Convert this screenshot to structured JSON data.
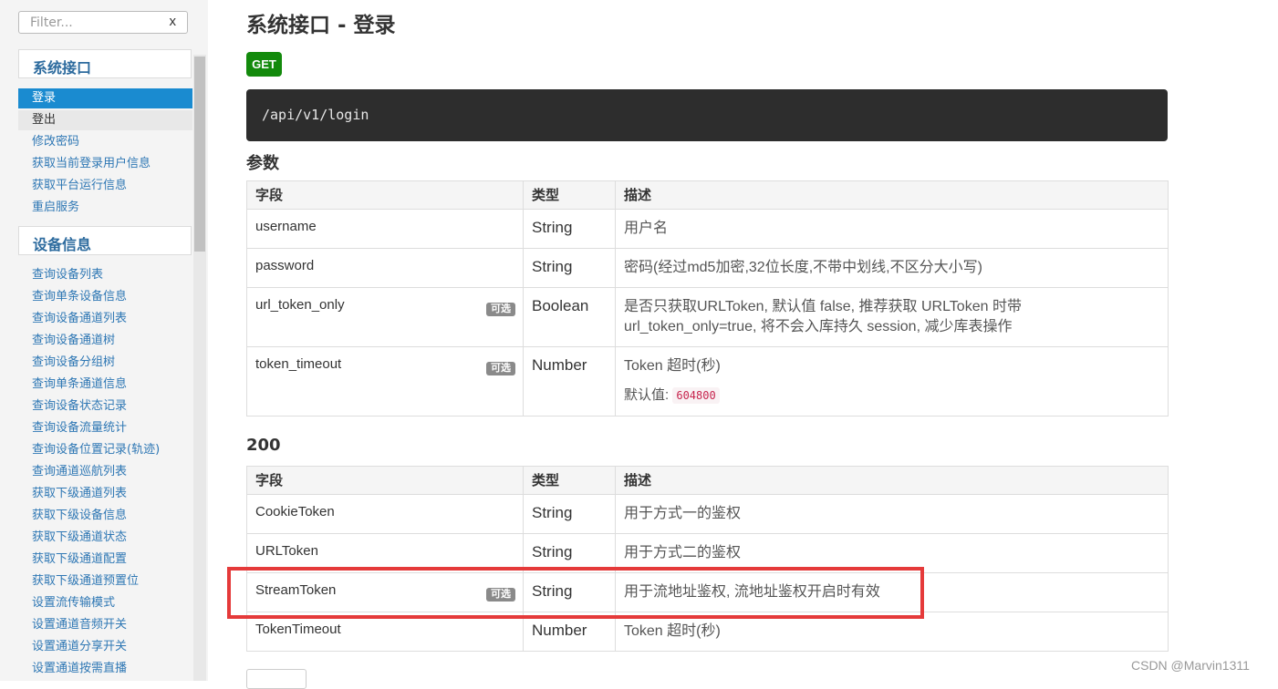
{
  "sidebar": {
    "filter_placeholder": "Filter...",
    "filter_clear": "x",
    "groups": [
      {
        "title": "系统接口",
        "items": [
          "登录",
          "登出",
          "修改密码",
          "获取当前登录用户信息",
          "获取平台运行信息",
          "重启服务"
        ]
      },
      {
        "title": "设备信息",
        "items": [
          "查询设备列表",
          "查询单条设备信息",
          "查询设备通道列表",
          "查询设备通道树",
          "查询设备分组树",
          "查询单条通道信息",
          "查询设备状态记录",
          "查询设备流量统计",
          "查询设备位置记录(轨迹)",
          "查询通道巡航列表",
          "获取下级通道列表",
          "获取下级设备信息",
          "获取下级通道状态",
          "获取下级通道配置",
          "获取下级通道预置位",
          "设置流传输模式",
          "设置通道音频开关",
          "设置通道分享开关",
          "设置通道按需直播"
        ]
      }
    ]
  },
  "main": {
    "title": "系统接口 - 登录",
    "method": "GET",
    "endpoint": "/api/v1/login",
    "params_title": "参数",
    "response_title": "200",
    "headers": [
      "字段",
      "类型",
      "描述"
    ],
    "optional_label": "可选",
    "default_label": "默认值:",
    "params": [
      {
        "field": "username",
        "type": "String",
        "desc": "用户名"
      },
      {
        "field": "password",
        "type": "String",
        "desc": "密码(经过md5加密,32位长度,不带中划线,不区分大小写)"
      },
      {
        "field": "url_token_only",
        "type": "Boolean",
        "desc_line1": "是否只获取URLToken, 默认值 false, 推荐获取 URLToken 时带",
        "desc_line2": "url_token_only=true, 将不会入库持久 session, 减少库表操作"
      },
      {
        "field": "token_timeout",
        "type": "Number",
        "desc": "Token 超时(秒)",
        "default": "604800"
      }
    ],
    "response": [
      {
        "field": "CookieToken",
        "type": "String",
        "desc": "用于方式一的鉴权"
      },
      {
        "field": "URLToken",
        "type": "String",
        "desc": "用于方式二的鉴权"
      },
      {
        "field": "StreamToken",
        "type": "String",
        "desc": "用于流地址鉴权, 流地址鉴权开启时有效"
      },
      {
        "field": "TokenTimeout",
        "type": "Number",
        "desc": "Token 超时(秒)"
      }
    ]
  },
  "watermark": "CSDN @Marvin1311",
  "colors": {
    "accent": "#1a8bd0",
    "get_badge": "#138a0c",
    "highlight": "#e53a3a",
    "endpoint_bg": "#2d2d2d"
  }
}
